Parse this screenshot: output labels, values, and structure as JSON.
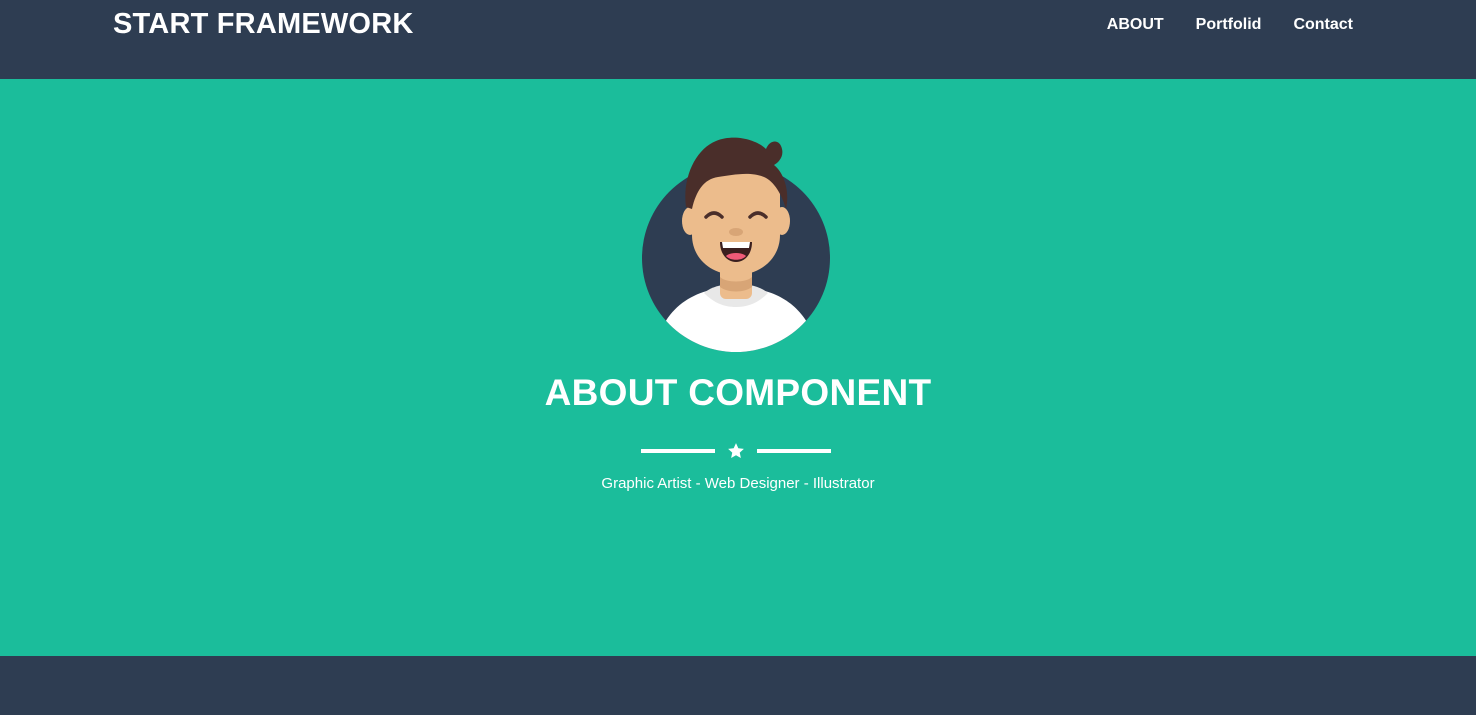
{
  "navbar": {
    "brand": "START FRAMEWORK",
    "links": [
      {
        "label": "ABOUT"
      },
      {
        "label": "Portfolid"
      },
      {
        "label": "Contact"
      }
    ]
  },
  "hero": {
    "avatar_icon": "smiling-person-avatar-icon",
    "title": "ABOUT COMPONENT",
    "divider_icon": "star-icon",
    "subtitle": "Graphic Artist - Web Designer - Illustrator"
  },
  "colors": {
    "navbar_bg": "#2e3d52",
    "hero_bg": "#1bbd9b",
    "text": "#ffffff",
    "avatar_circle": "#2e3d52",
    "hair": "#4a2e2a",
    "skin": "#ecbc8c",
    "shirt": "#ffffff"
  }
}
